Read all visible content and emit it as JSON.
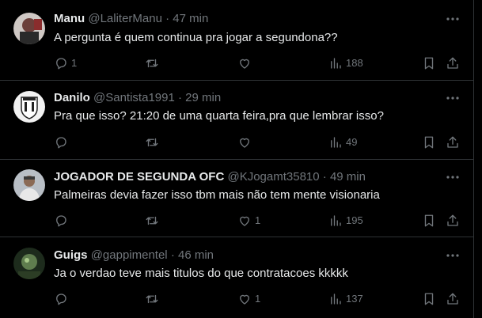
{
  "tweets": [
    {
      "name": "Manu",
      "handle": "@LaliterManu",
      "dot": "·",
      "time": "47 min",
      "text": "A pergunta é quem continua pra jogar a segundona??",
      "replies": "1",
      "retweets": "",
      "likes": "",
      "views": "188",
      "avatar_color": "#7a5a55"
    },
    {
      "name": "Danilo",
      "handle": "@Santista1991",
      "dot": "·",
      "time": "29 min",
      "text": "Pra que isso? 21:20 de uma quarta feira,pra que lembrar isso?",
      "replies": "",
      "retweets": "",
      "likes": "",
      "views": "49",
      "avatar_color": "#d8d8d8"
    },
    {
      "name": "JOGADOR DE SEGUNDA OFC",
      "handle": "@KJogamt35810",
      "dot": "·",
      "time": "49 min",
      "text": "Palmeiras devia fazer isso tbm mais não tem mente visionaria",
      "replies": "",
      "retweets": "",
      "likes": "1",
      "views": "195",
      "avatar_color": "#9aa0a6"
    },
    {
      "name": "Guigs",
      "handle": "@gappimentel",
      "dot": "·",
      "time": "46 min",
      "text": "Ja o verdao teve mais titulos do que contratacoes kkkkk",
      "replies": "",
      "retweets": "",
      "likes": "1",
      "views": "137",
      "avatar_color": "#3d5a3a"
    }
  ],
  "icons": {
    "reply": "reply-icon",
    "retweet": "retweet-icon",
    "like": "like-icon",
    "views": "views-icon",
    "bookmark": "bookmark-icon",
    "share": "share-icon",
    "more": "more-icon"
  },
  "colors": {
    "background": "#000000",
    "text": "#e7e9ea",
    "secondary": "#71767b",
    "divider": "#2f3336"
  }
}
